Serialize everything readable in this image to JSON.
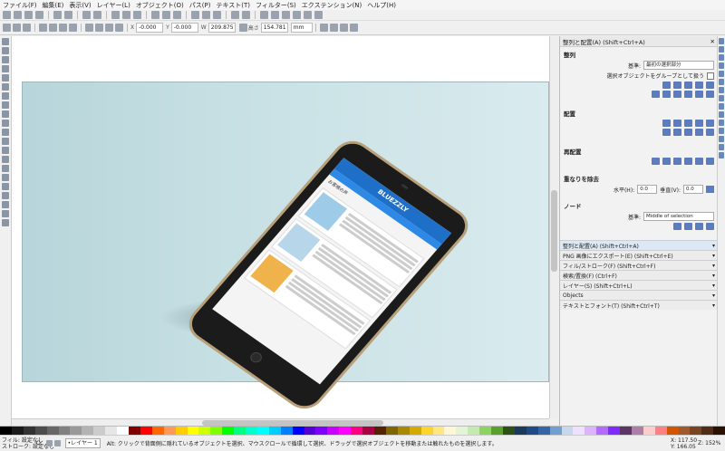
{
  "menu": [
    "ファイル(F)",
    "編集(E)",
    "表示(V)",
    "レイヤー(L)",
    "オブジェクト(O)",
    "パス(P)",
    "テキスト(T)",
    "フィルター(S)",
    "エクステンション(N)",
    "ヘルプ(H)"
  ],
  "toolctrl": {
    "x_label": "X",
    "x_value": "-0.000",
    "y_label": "Y",
    "y_value": "-0.000",
    "w_label": "W",
    "w_value": "209.875",
    "h_label": "高さ",
    "h_value": "154.781",
    "unit": "mm"
  },
  "panel": {
    "title": "整列と配置(A) (Shift+Ctrl+A)",
    "align_heading": "整列",
    "relative_label": "基準:",
    "relative_value": "最初の選択部分",
    "group_label": "選択オブジェクトをグループとして扱う",
    "distribute_heading": "配置",
    "rearrange_heading": "再配置",
    "overlap_heading": "重なりを除去",
    "h_label": "水平(H):",
    "h_value": "0.0",
    "v_label": "垂直(V):",
    "v_value": "0.0",
    "nodes_heading": "ノード",
    "nodes_relative_label": "基準:",
    "nodes_relative_value": "Middle of selection"
  },
  "dock": [
    "整列と配置(A) (Shift+Ctrl+A)",
    "PNG 画像にエクスポート(E) (Shift+Ctrl+E)",
    "フィル/ストローク(F) (Shift+Ctrl+F)",
    "検索/置換(F) (Ctrl+F)",
    "レイヤー(S) (Shift+Ctrl+L)",
    "Objects",
    "テキストとフォント(T) (Shift+Ctrl+T)"
  ],
  "phone": {
    "brand": "BLUEZZLY",
    "page_title": "お客様の声"
  },
  "status": {
    "fill_label": "フィル:",
    "fill_value": "設定なし",
    "stroke_label": "ストローク:",
    "stroke_value": "設定なし",
    "opacity": "O:",
    "layer": "•レイヤー 1",
    "message": "Alt: クリックで背面側に隠れているオブジェクトを選択、マウスクロールで循環して選択、ドラッグで選択オブジェクトを移動または触れたものを選択します。",
    "x": "X: 117.50",
    "y": "Y: 166.05",
    "zoom_label": "Z:",
    "zoom": "152%"
  },
  "palette": [
    "#000000",
    "#1a1a1a",
    "#333333",
    "#4d4d4d",
    "#666666",
    "#808080",
    "#999999",
    "#b3b3b3",
    "#cccccc",
    "#e6e6e6",
    "#ffffff",
    "#800000",
    "#ff0000",
    "#ff6600",
    "#ff9955",
    "#ffcc00",
    "#ffff00",
    "#ccff00",
    "#80ff00",
    "#00ff00",
    "#00ff80",
    "#00ffcc",
    "#00ffff",
    "#00ccff",
    "#0080ff",
    "#0000ff",
    "#5500d4",
    "#8000ff",
    "#cc00ff",
    "#ff00ff",
    "#ff0080",
    "#aa0044",
    "#552200",
    "#806600",
    "#aa8800",
    "#d4aa00",
    "#ffd42a",
    "#ffe680",
    "#fff6d5",
    "#e3f4d7",
    "#c6e9af",
    "#8dd35f",
    "#5aa02c",
    "#2d5016",
    "#1a3a5c",
    "#204a87",
    "#3465a4",
    "#729fcf",
    "#c5d8ee",
    "#f0e0ff",
    "#dbb3ff",
    "#b26bff",
    "#7f2aff",
    "#5c3566",
    "#ad7fa8",
    "#ffcccc",
    "#ff8080",
    "#d45500",
    "#a05a2c",
    "#784421",
    "#502d16",
    "#2b1100"
  ]
}
